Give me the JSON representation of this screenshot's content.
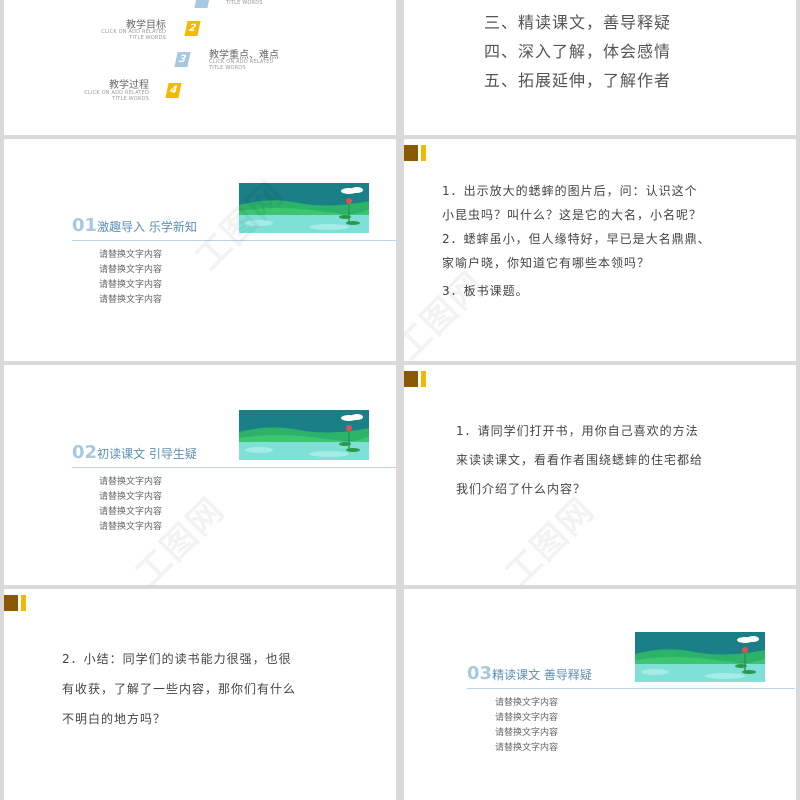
{
  "colors": {
    "dark_accent": "#8a5a00",
    "gold_accent": "#f5b800",
    "blue_title": "#5b8fb5",
    "num_color": "#a7c9e0"
  },
  "outline": {
    "items": [
      {
        "num": "2",
        "title": "教学目标",
        "sub": "CLICK ON ADD RELATED\nTITLE WORDS",
        "color": "#f5b800"
      },
      {
        "num": "3",
        "title": "教学重点、难点",
        "sub": "CLICK ON ADD RELATED\nTITLE WORDS",
        "color": "#a7c9e0"
      },
      {
        "num": "4",
        "title": "教学过程",
        "sub": "CLICK ON ADD RELATED\nTITLE WORDS",
        "color": "#f5b800"
      }
    ],
    "top_sub": "TITLE WORDS",
    "agenda": [
      "三、精读课文，善导释疑",
      "四、深入了解，体会感情",
      "五、拓展延伸，了解作者"
    ]
  },
  "sections": [
    {
      "num": "01",
      "name": "激趣导入 乐学新知",
      "items": [
        "请替换文字内容",
        "请替换文字内容",
        "请替换文字内容",
        "请替换文字内容"
      ]
    },
    {
      "num": "02",
      "name": "初读课文 引导生疑",
      "items": [
        "请替换文字内容",
        "请替换文字内容",
        "请替换文字内容",
        "请替换文字内容"
      ]
    },
    {
      "num": "03",
      "name": "精读课文 善导释疑",
      "items": [
        "请替换文字内容",
        "请替换文字内容",
        "请替换文字内容",
        "请替换文字内容"
      ]
    }
  ],
  "text_slides": {
    "s4": [
      "1．出示放大的蟋蟀的图片后，问：认识这个",
      "小昆虫吗？叫什么？这是它的大名，小名呢？",
      "2．蟋蟀虽小，但人缘特好，早已是大名鼎鼎、",
      "家喻户晓，你知道它有哪些本领吗？",
      "3．板书课题。"
    ],
    "s6": [
      "1．请同学们打开书，用你自己喜欢的方法",
      "来读读课文，看看作者围绕蟋蟀的住宅都给",
      "我们介绍了什么内容？"
    ],
    "s7": [
      "2．小结：同学们的读书能力很强，也很",
      "有收获，了解了一些内容，那你们有什么",
      "不明白的地方吗？"
    ]
  }
}
